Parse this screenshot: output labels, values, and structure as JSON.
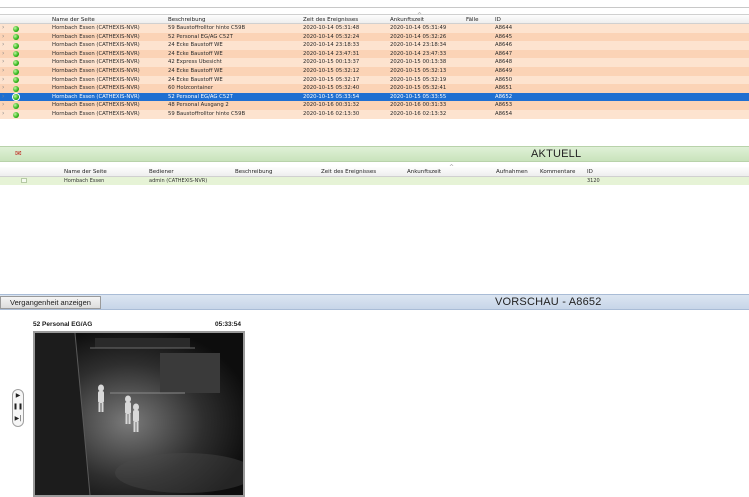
{
  "alarm_table": {
    "headers": {
      "name": "Name der Seite",
      "beschreibung": "Beschreibung",
      "zeit": "Zeit des Ereignisses",
      "ankunft": "Ankunftszeit",
      "faelle": "Fälle",
      "id": "ID"
    },
    "rows": [
      {
        "name": "Hornbach Essen  (CATHEXIS-NVR)",
        "beschreibung": "59 Baustoffrolltor hinte C59B",
        "zeit": "2020-10-14 05:31:48",
        "ankunft": "2020-10-14 05:31:49",
        "id": "A8644",
        "selected": false
      },
      {
        "name": "Hornbach Essen  (CATHEXIS-NVR)",
        "beschreibung": "52 Personal EG/AG C52T",
        "zeit": "2020-10-14 05:32:24",
        "ankunft": "2020-10-14 05:32:26",
        "id": "A8645",
        "selected": false
      },
      {
        "name": "Hornbach Essen  (CATHEXIS-NVR)",
        "beschreibung": "24 Ecke Baustoff WE",
        "zeit": "2020-10-14 23:18:33",
        "ankunft": "2020-10-14 23:18:34",
        "id": "A8646",
        "selected": false
      },
      {
        "name": "Hornbach Essen  (CATHEXIS-NVR)",
        "beschreibung": "24 Ecke Baustoff WE",
        "zeit": "2020-10-14 23:47:31",
        "ankunft": "2020-10-14 23:47:33",
        "id": "A8647",
        "selected": false
      },
      {
        "name": "Hornbach Essen  (CATHEXIS-NVR)",
        "beschreibung": "42 Express Ubesicht",
        "zeit": "2020-10-15 00:13:37",
        "ankunft": "2020-10-15 00:13:38",
        "id": "A8648",
        "selected": false
      },
      {
        "name": "Hornbach Essen  (CATHEXIS-NVR)",
        "beschreibung": "24 Ecke Baustoff WE",
        "zeit": "2020-10-15 05:32:12",
        "ankunft": "2020-10-15 05:32:13",
        "id": "A8649",
        "selected": false
      },
      {
        "name": "Hornbach Essen  (CATHEXIS-NVR)",
        "beschreibung": "24 Ecke Baustoff WE",
        "zeit": "2020-10-15 05:32:17",
        "ankunft": "2020-10-15 05:32:19",
        "id": "A8650",
        "selected": false
      },
      {
        "name": "Hornbach Essen  (CATHEXIS-NVR)",
        "beschreibung": "60 Holzcontainer",
        "zeit": "2020-10-15 05:32:40",
        "ankunft": "2020-10-15 05:32:41",
        "id": "A8651",
        "selected": false
      },
      {
        "name": "Hornbach Essen  (CATHEXIS-NVR)",
        "beschreibung": "52 Personal EG/AG C52T",
        "zeit": "2020-10-15 05:33:54",
        "ankunft": "2020-10-15 05:33:55",
        "id": "A8652",
        "selected": true
      },
      {
        "name": "Hornbach Essen  (CATHEXIS-NVR)",
        "beschreibung": "48 Personal Ausgang 2",
        "zeit": "2020-10-16 00:31:32",
        "ankunft": "2020-10-16 00:31:33",
        "id": "A8653",
        "selected": false
      },
      {
        "name": "Hornbach Essen  (CATHEXIS-NVR)",
        "beschreibung": "59 Baustoffrolltor hinte C59B",
        "zeit": "2020-10-16 02:13:30",
        "ankunft": "2020-10-16 02:13:32",
        "id": "A8654",
        "selected": false
      }
    ]
  },
  "aktuell": {
    "title": "AKTUELL",
    "headers": {
      "name": "Name der Seite",
      "bediener": "Bediener",
      "beschreibung": "Beschreibung",
      "zeit": "Zeit des Ereignisses",
      "ankunft": "Ankunftszeit",
      "aufnahmen": "Aufnahmen",
      "kommentare": "Kommentare",
      "id": "ID"
    },
    "row": {
      "name": "Hornbach Essen",
      "bediener": "admin (CATHEXIS-NVR)",
      "id": "3120"
    }
  },
  "vorschau": {
    "history_button": "Vergangenheit anzeigen",
    "title": "VORSCHAU - A8652",
    "camera_name": "52 Personal EG/AG",
    "camera_time": "05:33:54"
  },
  "colors": {
    "row_odd": "#fde3cf",
    "row_even": "#fbd3b6",
    "selected": "#1f6fd1",
    "status_green": "#2fb418",
    "section_green": "#cfe7c3",
    "vorschau_blue": "#cfdcec"
  },
  "icons": {
    "status": "green-dot-icon",
    "expand": "chevron-right-icon",
    "section": "alarm-bell-icon",
    "play": "play-icon",
    "pause": "pause-icon",
    "step": "step-forward-icon"
  }
}
